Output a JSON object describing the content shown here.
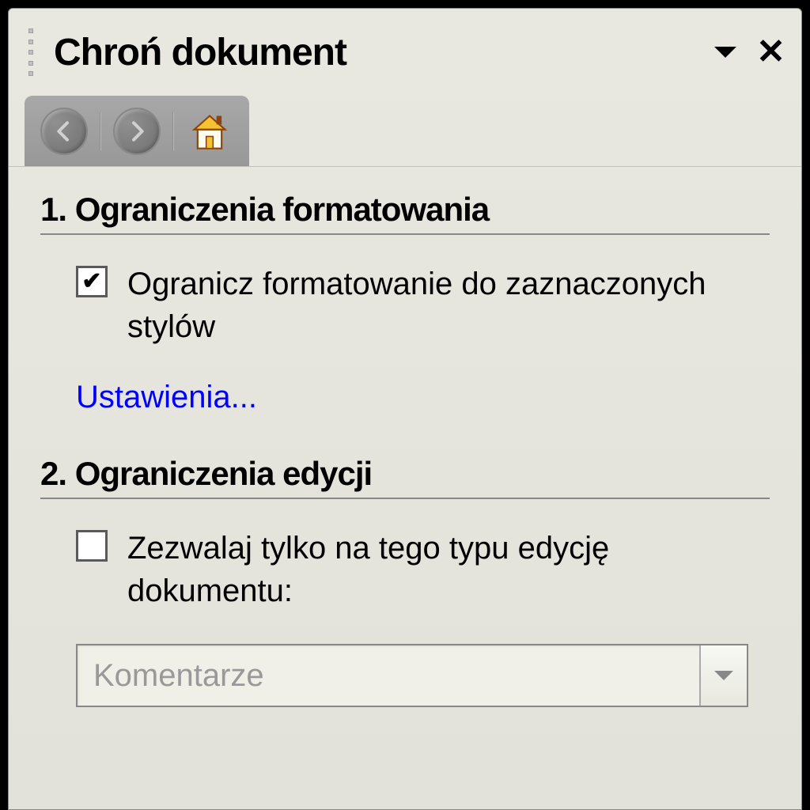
{
  "header": {
    "title": "Chroń dokument"
  },
  "section1": {
    "heading": "1. Ograniczenia formatowania",
    "checkbox_checked": true,
    "checkbox_label": "Ogranicz formatowanie do zaznaczonych stylów",
    "link": "Ustawienia..."
  },
  "section2": {
    "heading": "2. Ograniczenia edycji",
    "checkbox_checked": false,
    "checkbox_label": "Zezwalaj tylko na tego typu edycję dokumentu:",
    "select_value": "Komentarze"
  }
}
